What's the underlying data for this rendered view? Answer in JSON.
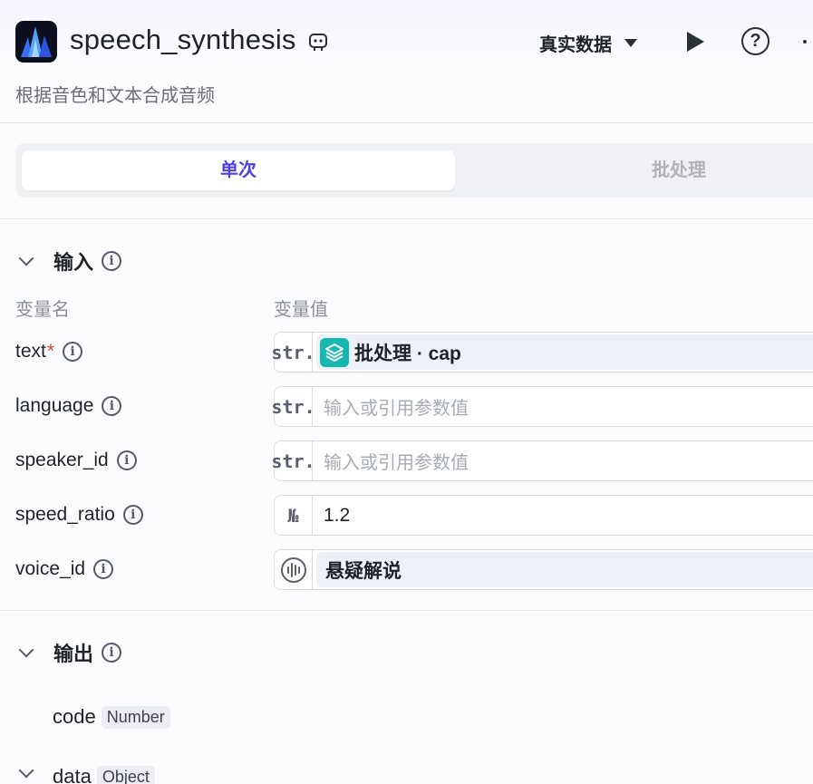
{
  "header": {
    "title": "speech_synthesis",
    "description": "根据音色和文本合成音频",
    "mode_label": "真实数据",
    "help_label": "?"
  },
  "tabs": [
    {
      "label": "单次",
      "active": true
    },
    {
      "label": "批处理",
      "active": false
    }
  ],
  "input_section": {
    "title": "输入",
    "col_name": "变量名",
    "col_value": "变量值",
    "rows": [
      {
        "name": "text",
        "required": "*",
        "type": "str.",
        "ref_label": "批处理 · cap"
      },
      {
        "name": "language",
        "type": "str.",
        "placeholder": "输入或引用参数值"
      },
      {
        "name": "speaker_id",
        "type": "str.",
        "placeholder": "输入或引用参数值"
      },
      {
        "name": "speed_ratio",
        "type": "№",
        "value": "1.2"
      },
      {
        "name": "voice_id",
        "voice_value": "悬疑解说"
      }
    ]
  },
  "output_section": {
    "title": "输出",
    "rows": [
      {
        "name": "code",
        "type": "Number"
      },
      {
        "name": "data",
        "type": "Object"
      }
    ]
  },
  "colors": {
    "accent": "#4e40e5",
    "ref_icon_bg": "#14b8b0",
    "required": "#e53e3e"
  },
  "icons": [
    "app-logo-icon",
    "node-template-icon",
    "play-icon",
    "help-icon",
    "more-icon",
    "chevron-down-icon",
    "info-icon",
    "batch-layers-icon",
    "voice-wave-icon"
  ]
}
